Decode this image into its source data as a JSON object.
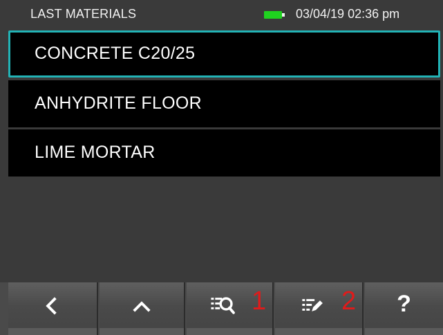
{
  "status_bar": {
    "title": "LAST MATERIALS",
    "datetime": "03/04/19 02:36 pm",
    "battery_color": "#1fd21f"
  },
  "materials": {
    "items": [
      {
        "label": "CONCRETE C20/25",
        "selected": true
      },
      {
        "label": "ANHYDRITE FLOOR",
        "selected": false
      },
      {
        "label": "LIME MORTAR",
        "selected": false
      }
    ],
    "selection_color": "#22b3b6"
  },
  "toolbar": {
    "buttons": [
      {
        "icon": "chevron-left-icon"
      },
      {
        "icon": "chevron-up-icon"
      },
      {
        "icon": "list-search-icon",
        "number": "1"
      },
      {
        "icon": "list-edit-icon",
        "number": "2"
      },
      {
        "icon": "help-icon",
        "glyph": "?"
      }
    ],
    "number_color": "#e01b1b"
  }
}
